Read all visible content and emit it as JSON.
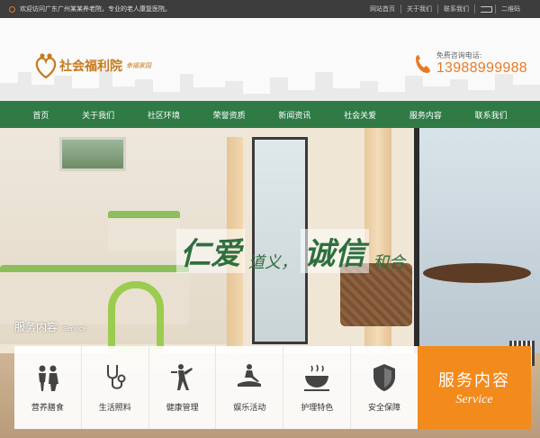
{
  "topbar": {
    "welcome": "欢迎访问广东广州某某养老院，专业的老人康复医院。",
    "links": [
      "网站首页",
      "关于我们",
      "联系我们"
    ],
    "qr_label": "二维码"
  },
  "header": {
    "brand": "社会福利院",
    "brand_sub": "幸福家园",
    "hotline_label": "免费咨询电话:",
    "hotline_number": "13988999988"
  },
  "nav": [
    "首页",
    "关于我们",
    "社区环境",
    "荣誉资质",
    "新闻资讯",
    "社会关爱",
    "服务内容",
    "联系我们"
  ],
  "banner": {
    "slogan": [
      "仁爱",
      "道义，",
      "诚信",
      "和合"
    ]
  },
  "services": {
    "title": "服务内容",
    "title_en": "Service",
    "items": [
      {
        "label": "营养膳食",
        "icon": "people-icon"
      },
      {
        "label": "生活照料",
        "icon": "stethoscope-icon"
      },
      {
        "label": "健康管理",
        "icon": "exercise-icon"
      },
      {
        "label": "娱乐活动",
        "icon": "massage-icon"
      },
      {
        "label": "护理特色",
        "icon": "bowl-icon"
      },
      {
        "label": "安全保障",
        "icon": "shield-icon"
      }
    ],
    "cta": "服务内容",
    "cta_en": "Service"
  },
  "colors": {
    "nav_green": "#2f7a45",
    "accent_orange": "#f28a1c",
    "topbar": "#3d3d3d"
  }
}
